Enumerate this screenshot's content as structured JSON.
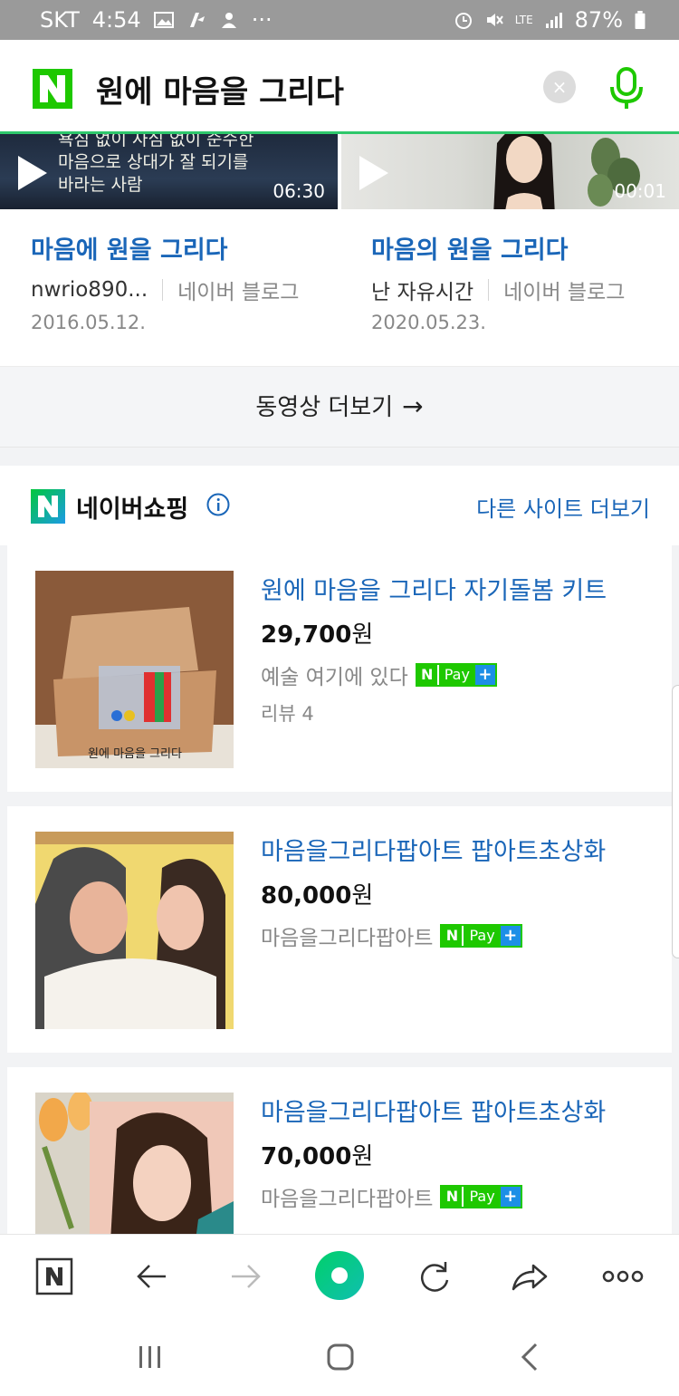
{
  "status_bar": {
    "carrier": "SKT",
    "time": "4:54",
    "dots": "···",
    "battery": "87%",
    "network": "LTE"
  },
  "search": {
    "query": "원에 마음을 그리다",
    "clear_label": "×"
  },
  "videos": [
    {
      "title": "마음에 원을 그리다",
      "author": "nwrio890...",
      "source": "네이버 블로그",
      "date": "2016.05.12.",
      "duration": "06:30",
      "thumb_text": [
        "욕심 없이 사심 없이 순수한",
        "마음으로 상대가 잘 되기를",
        "바라는 사람"
      ]
    },
    {
      "title": "마음의 원을 그리다",
      "author": "난 자유시간",
      "source": "네이버 블로그",
      "date": "2020.05.23.",
      "duration": "00:01"
    }
  ],
  "more_videos_label": "동영상 더보기",
  "more_videos_arrow": "→",
  "shopping": {
    "title": "네이버쇼핑",
    "more_label": "다른 사이트 더보기",
    "products": [
      {
        "title": "원에 마음을 그리다 자기돌봄 키트",
        "price": "29,700",
        "currency": "원",
        "seller": "예술 여기에 있다",
        "review": "리뷰 4",
        "image_text": "원에 마음을 그리다"
      },
      {
        "title": "마음을그리다팝아트 팝아트초상화",
        "price": "80,000",
        "currency": "원",
        "seller": "마음을그리다팝아트"
      },
      {
        "title": "마음을그리다팝아트 팝아트초상화",
        "price": "70,000",
        "currency": "원",
        "seller": "마음을그리다팝아트"
      }
    ],
    "npay": {
      "n": "N",
      "pay": "Pay",
      "plus": "+"
    }
  },
  "colors": {
    "naver_green": "#1ec800",
    "link_blue": "#1a66b8",
    "accent_line": "#2ec76b"
  }
}
